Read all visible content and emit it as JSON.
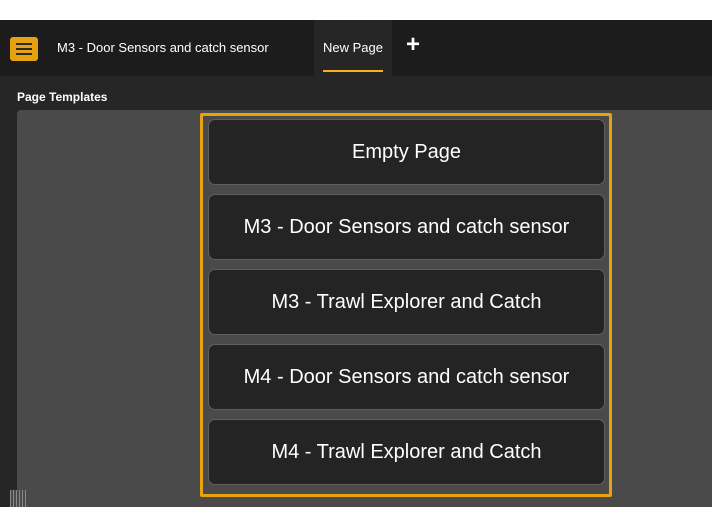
{
  "tabbar": {
    "menu_icon": "hamburger-menu-icon",
    "tabs": [
      {
        "label": "M3 - Door Sensors and catch sensor",
        "active": false
      },
      {
        "label": "New Page",
        "active": true
      }
    ],
    "add_tab_symbol": "+",
    "accent_color": "#e8a20f"
  },
  "section": {
    "title": "Page Templates"
  },
  "templates": [
    {
      "label": "Empty Page"
    },
    {
      "label": "M3 - Door Sensors and catch sensor"
    },
    {
      "label": "M3 - Trawl Explorer and Catch"
    },
    {
      "label": "M4 - Door Sensors and catch sensor"
    },
    {
      "label": "M4 - Trawl Explorer and Catch"
    }
  ]
}
